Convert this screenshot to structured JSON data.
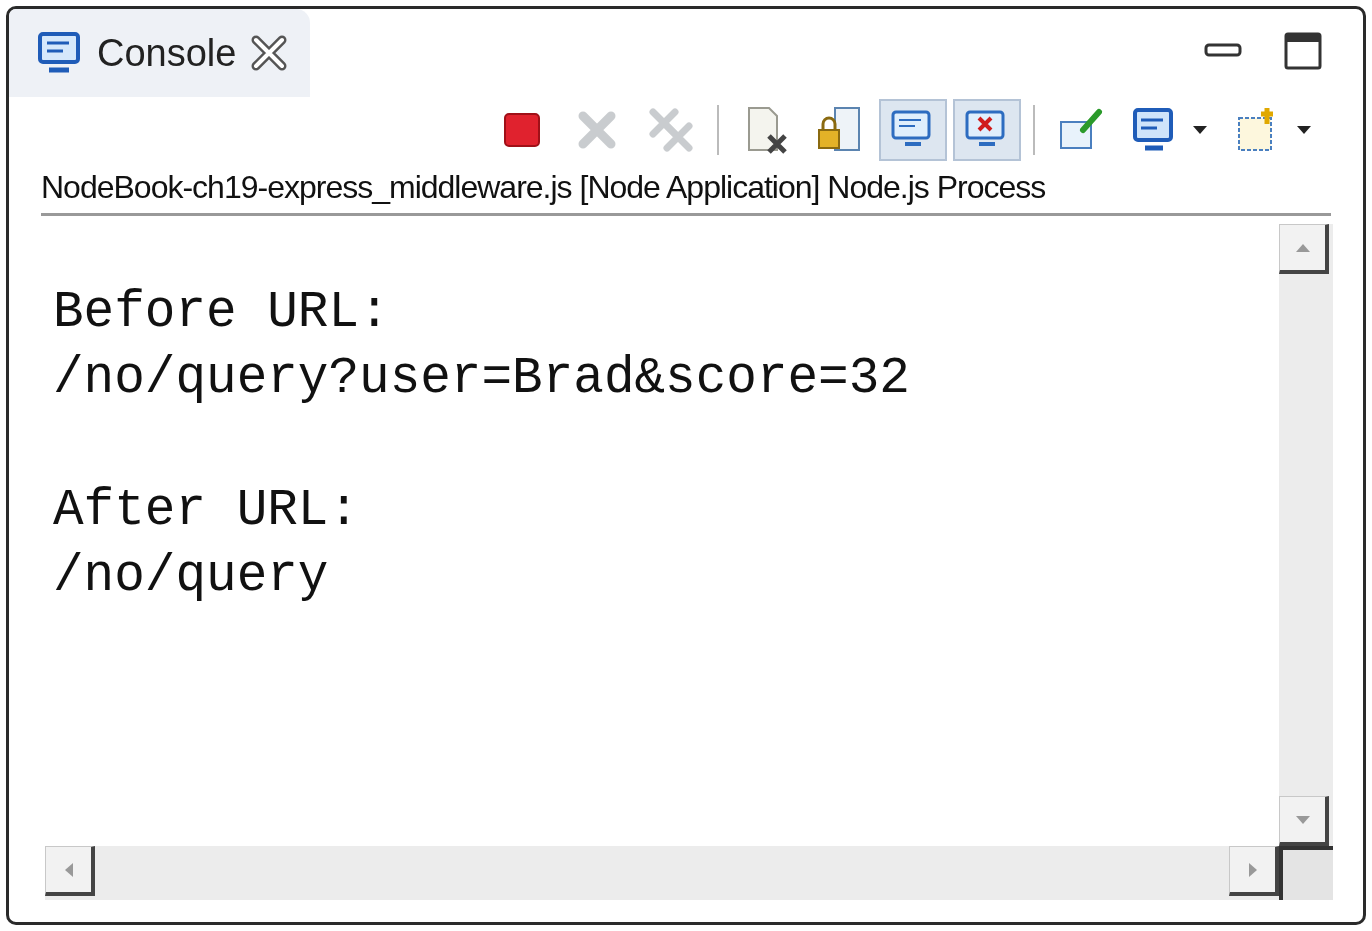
{
  "view_tab": {
    "label": "Console",
    "selected": true
  },
  "toolbar": [
    {
      "pressed": false,
      "disabled": false
    },
    {
      "pressed": false,
      "disabled": true
    },
    {
      "pressed": false,
      "disabled": true
    },
    {
      "pressed": false,
      "disabled": false
    },
    {
      "pressed": false,
      "disabled": false
    },
    {
      "pressed": true,
      "disabled": false
    },
    {
      "pressed": true,
      "disabled": false
    },
    {
      "pressed": false,
      "disabled": false
    },
    {
      "pressed": false,
      "disabled": false
    },
    {
      "pressed": false,
      "disabled": false
    }
  ],
  "process_label": "NodeBook-ch19-express_middleware.js [Node Application] Node.js Process",
  "output_blocks": [
    [
      "Before URL:",
      "/no/query?user=Brad&score=32"
    ],
    [
      "After URL:",
      "/no/query"
    ]
  ]
}
